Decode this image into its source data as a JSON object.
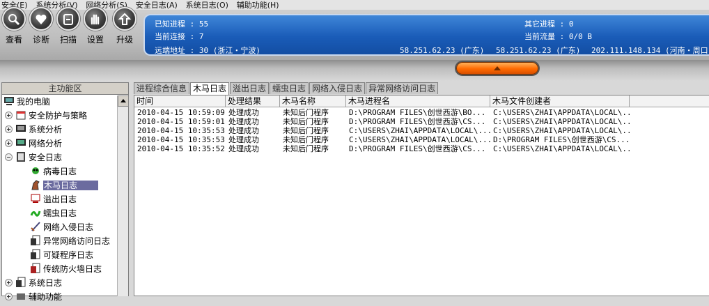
{
  "menu": [
    "安全(E)",
    "系统分析(V)",
    "网络分析(S)",
    "安全日志(A)",
    "系统日志(O)",
    "辅助功能(H)"
  ],
  "toolbar": {
    "buttons": [
      {
        "label": "查看",
        "icon": "magnifier-icon"
      },
      {
        "label": "诊断",
        "icon": "heart-icon"
      },
      {
        "label": "扫描",
        "icon": "scan-icon"
      },
      {
        "label": "设置",
        "icon": "hand-icon"
      },
      {
        "label": "升级",
        "icon": "upgrade-icon"
      }
    ]
  },
  "status": {
    "known_processes": "已知进程 : 55",
    "other_processes": "其它进程 : 0",
    "connections": "当前连接 : 7",
    "traffic": "当前流量 : 0/0 B",
    "remote_address": "远端地址 : 30 (浙江・宁波)",
    "ips": [
      "58.251.62.23 (广东)",
      "58.251.62.23 (广东)",
      "202.111.148.134 (河南・周口)"
    ]
  },
  "sidebar": {
    "header": "主功能区",
    "items": [
      {
        "label": "我的电脑",
        "icon": "computer-icon"
      },
      {
        "label": "安全防护与策略",
        "icon": "policy-icon"
      },
      {
        "label": "系统分析",
        "icon": "monitor-icon"
      },
      {
        "label": "网络分析",
        "icon": "network-icon"
      },
      {
        "label": "安全日志",
        "icon": "log-book-icon"
      },
      {
        "label": "病毒日志",
        "icon": "virus-icon"
      },
      {
        "label": "木马日志",
        "icon": "horse-icon"
      },
      {
        "label": "溢出日志",
        "icon": "overflow-icon"
      },
      {
        "label": "蠕虫日志",
        "icon": "worm-icon"
      },
      {
        "label": "网络入侵日志",
        "icon": "sword-icon"
      },
      {
        "label": "异常网络访问日志",
        "icon": "doc-icon"
      },
      {
        "label": "可疑程序日志",
        "icon": "doc-icon"
      },
      {
        "label": "传统防火墙日志",
        "icon": "doc-icon"
      },
      {
        "label": "系统日志",
        "icon": "doc-icon"
      },
      {
        "label": "辅助功能",
        "icon": "tool-icon"
      }
    ]
  },
  "tabs": [
    "进程综合信息",
    "木马日志",
    "溢出日志",
    "蠕虫日志",
    "网络入侵日志",
    "异常网络访问日志"
  ],
  "table": {
    "columns": [
      "时间",
      "处理结果",
      "木马名称",
      "木马进程名",
      "木马文件创建者"
    ],
    "rows": [
      [
        "2010-04-15 10:59:09",
        "处理成功",
        "未知后门程序",
        "D:\\PROGRAM FILES\\创世西游\\BO...",
        "C:\\USERS\\ZHAI\\APPDATA\\LOCAL\\..."
      ],
      [
        "2010-04-15 10:59:01",
        "处理成功",
        "未知后门程序",
        "D:\\PROGRAM FILES\\创世西游\\CS...",
        "C:\\USERS\\ZHAI\\APPDATA\\LOCAL\\..."
      ],
      [
        "2010-04-15 10:35:53",
        "处理成功",
        "未知后门程序",
        "C:\\USERS\\ZHAI\\APPDATA\\LOCAL\\...",
        "C:\\USERS\\ZHAI\\APPDATA\\LOCAL\\..."
      ],
      [
        "2010-04-15 10:35:53",
        "处理成功",
        "未知后门程序",
        "C:\\USERS\\ZHAI\\APPDATA\\LOCAL\\...",
        "D:\\PROGRAM FILES\\创世西游\\CS..."
      ],
      [
        "2010-04-15 10:35:52",
        "处理成功",
        "未知后门程序",
        "D:\\PROGRAM FILES\\创世西游\\CS...",
        "C:\\USERS\\ZHAI\\APPDATA\\LOCAL\\..."
      ]
    ]
  }
}
